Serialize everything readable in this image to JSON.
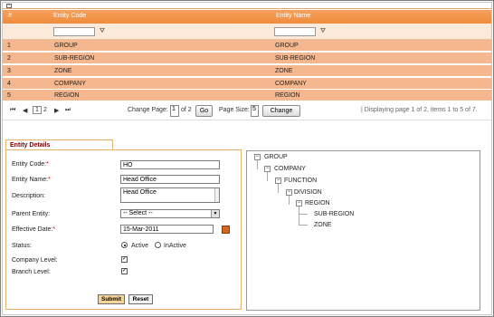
{
  "grid": {
    "collapse_glyph": "−",
    "columns": [
      "#",
      "Entity Code",
      "Entity Name"
    ],
    "rows": [
      {
        "num": "1",
        "code": "GROUP",
        "name": "GROUP"
      },
      {
        "num": "2",
        "code": "SUB-REGION",
        "name": "SUB-REGION"
      },
      {
        "num": "3",
        "code": "ZONE",
        "name": "ZONE"
      },
      {
        "num": "4",
        "code": "COMPANY",
        "name": "COMPANY"
      },
      {
        "num": "5",
        "code": "REGION",
        "name": "REGION"
      }
    ],
    "filter_icon": "funnel-icon"
  },
  "pager": {
    "first": "⏮",
    "prev": "◀",
    "next": "▶",
    "last": "⏭",
    "page1": "1",
    "page2": "2",
    "change_page_label": "Change Page:",
    "page_value": "1",
    "of_label": "of 2",
    "go_label": "Go",
    "page_size_label": "Page Size:",
    "page_size_value": "5",
    "change_label": "Change",
    "display_text": "|  Displaying page 1 of 2, items 1 to 5 of 7."
  },
  "form": {
    "legend": "Entity Details",
    "entity_code_label": "Entity Code:",
    "entity_code_value": "HO",
    "entity_name_label": "Entity Name:",
    "entity_name_value": "Head Office",
    "description_label": "Description:",
    "description_value": "Head Office",
    "parent_entity_label": "Parent Entity:",
    "parent_entity_value": "-- Select --",
    "effective_date_label": "Effective Date:",
    "effective_date_value": "15-Mar-2011",
    "status_label": "Status:",
    "status_active": "Active",
    "status_inactive": "InActive",
    "company_level_label": "Company Level:",
    "branch_level_label": "Branch Level:",
    "required_mark": "*",
    "submit_label": "Submit",
    "reset_label": "Reset",
    "accent_color": "#800000"
  },
  "tree": {
    "expand_glyph": "−",
    "nodes": [
      "GROUP",
      "COMPANY",
      "FUNCTION",
      "DIVISION",
      "REGION",
      "SUB-REGION",
      "ZONE"
    ]
  }
}
